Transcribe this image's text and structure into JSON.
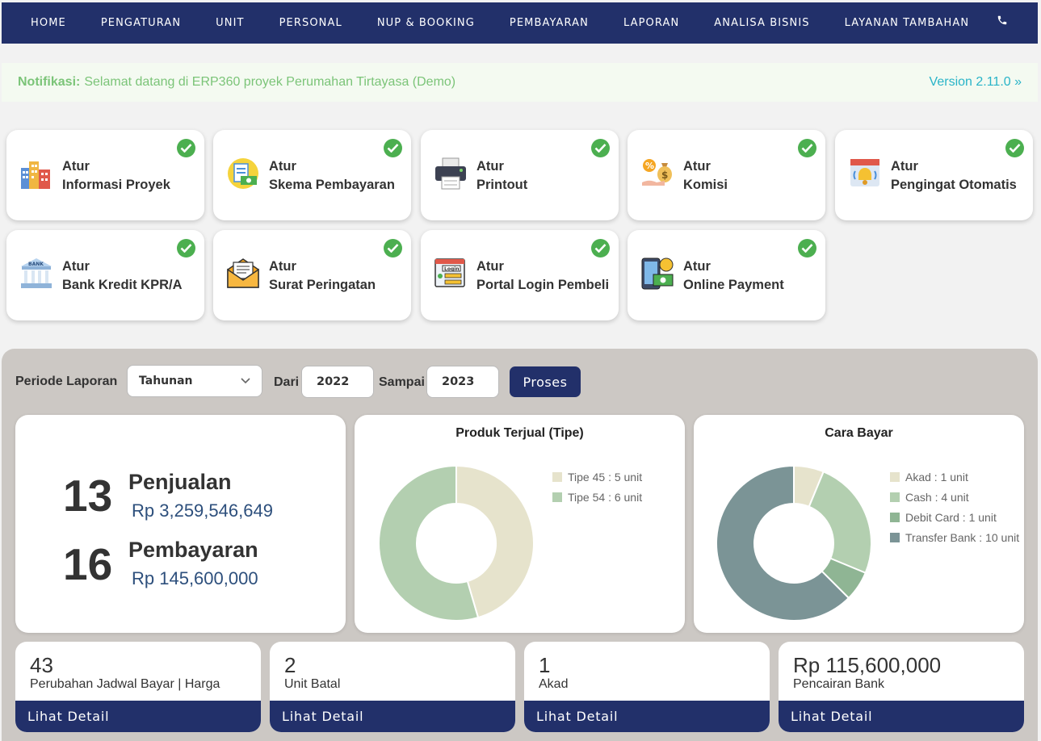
{
  "nav": {
    "items": [
      "HOME",
      "PENGATURAN",
      "UNIT",
      "PERSONAL",
      "NUP & BOOKING",
      "PEMBAYARAN",
      "LAPORAN",
      "ANALISA BISNIS",
      "LAYANAN TAMBAHAN"
    ],
    "phone_icon": "phone-icon"
  },
  "notif": {
    "label": "Notifikasi:",
    "text": "Selamat datang di ERP360 proyek Perumahan Tirtayasa (Demo)",
    "version": "Version 2.11.0 »"
  },
  "cards": [
    {
      "line1": "Atur",
      "line2": "Informasi Proyek",
      "icon": "buildings-icon"
    },
    {
      "line1": "Atur",
      "line2": "Skema Pembayaran",
      "icon": "payment-scheme-icon"
    },
    {
      "line1": "Atur",
      "line2": "Printout",
      "icon": "printer-icon"
    },
    {
      "line1": "Atur",
      "line2": "Komisi",
      "icon": "commission-icon"
    },
    {
      "line1": "Atur",
      "line2": "Pengingat Otomatis",
      "icon": "bell-calendar-icon"
    },
    {
      "line1": "Atur",
      "line2": "Bank Kredit KPR/A",
      "icon": "bank-icon"
    },
    {
      "line1": "Atur",
      "line2": "Surat Peringatan",
      "icon": "envelope-icon"
    },
    {
      "line1": "Atur",
      "line2": "Portal Login Pembeli",
      "icon": "login-portal-icon"
    },
    {
      "line1": "Atur",
      "line2": "Online Payment",
      "icon": "online-payment-icon"
    }
  ],
  "filter": {
    "periode_label": "Periode Laporan",
    "periode_value": "Tahunan",
    "dari_label": "Dari",
    "dari_value": "2022",
    "sampai_label": "Sampai",
    "sampai_value": "2023",
    "proses_label": "Proses"
  },
  "summary": {
    "penjualan_count": "13",
    "penjualan_label": "Penjualan",
    "penjualan_value": "Rp 3,259,546,649",
    "pembayaran_count": "16",
    "pembayaran_label": "Pembayaran",
    "pembayaran_value": "Rp 145,600,000"
  },
  "chart_data": [
    {
      "type": "pie",
      "title": "Produk Terjual (Tipe)",
      "categories": [
        "Tipe 45",
        "Tipe 54"
      ],
      "values": [
        5,
        6
      ],
      "legend": [
        "Tipe 45 : 5 unit",
        "Tipe 54 : 6 unit"
      ],
      "colors": [
        "#e6e3cc",
        "#b3cfb0"
      ],
      "legend_position": "right"
    },
    {
      "type": "pie",
      "title": "Cara Bayar",
      "categories": [
        "Akad",
        "Cash",
        "Debit Card",
        "Transfer Bank"
      ],
      "values": [
        1,
        4,
        1,
        10
      ],
      "legend": [
        "Akad : 1 unit",
        "Cash : 4 unit",
        "Debit Card : 1 unit",
        "Transfer Bank : 10 unit"
      ],
      "colors": [
        "#e6e3cc",
        "#b3cfb0",
        "#8fb594",
        "#7b9496"
      ],
      "legend_position": "right"
    }
  ],
  "stats": [
    {
      "value": "43",
      "label": "Perubahan Jadwal Bayar | Harga",
      "link": "Lihat Detail"
    },
    {
      "value": "2",
      "label": "Unit Batal",
      "link": "Lihat Detail"
    },
    {
      "value": "1",
      "label": "Akad",
      "link": "Lihat Detail"
    },
    {
      "value": "Rp 115,600,000",
      "label": "Pencairan Bank",
      "link": "Lihat Detail"
    }
  ],
  "colors": {
    "nav": "#22306a",
    "check": "#4caf50",
    "notif_text": "#7bc478",
    "version": "#29b4c8"
  }
}
